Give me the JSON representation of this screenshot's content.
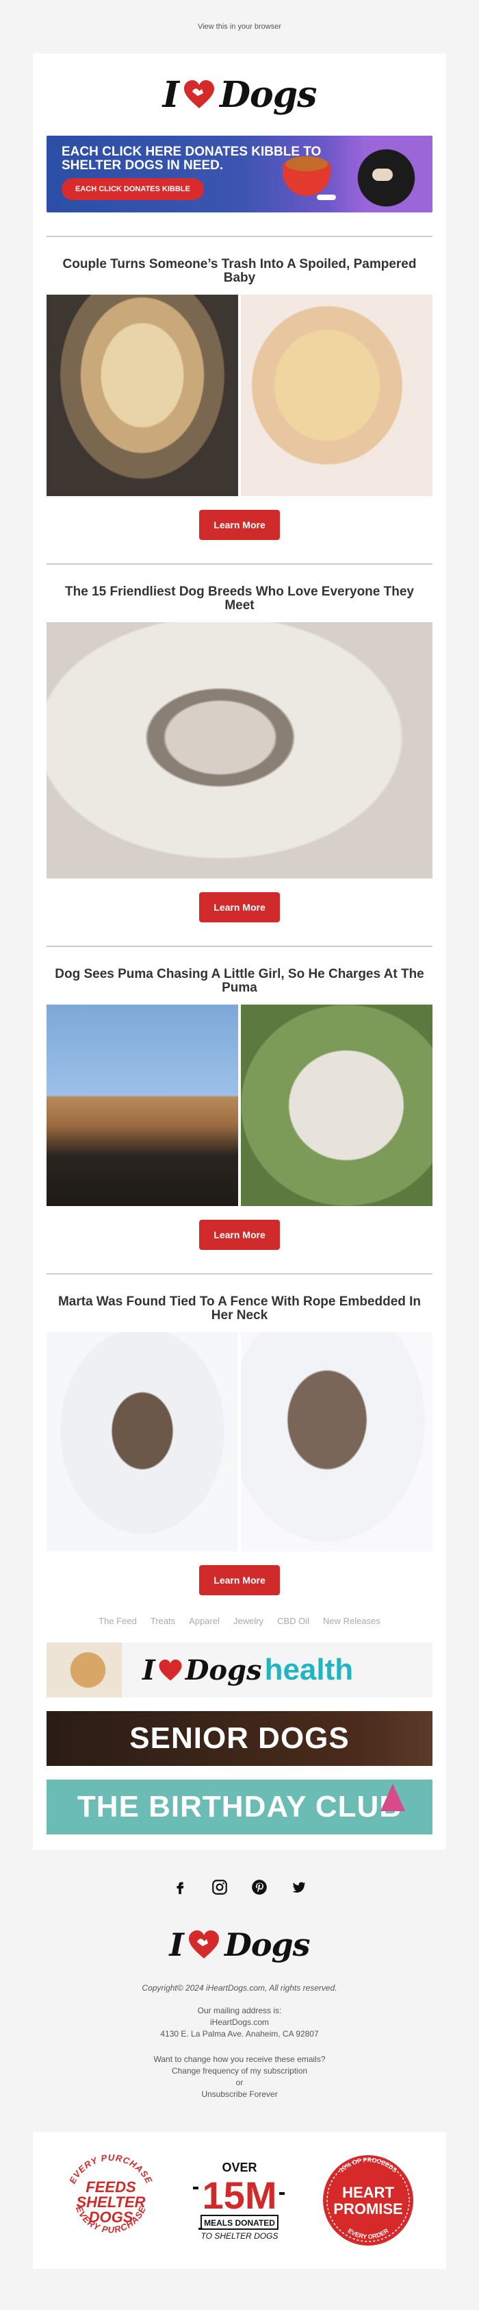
{
  "top_link": "View this in your browser",
  "brand": {
    "left": "I",
    "right": "Dogs"
  },
  "banner": {
    "headline": "EACH CLICK HERE DONATES KIBBLE TO SHELTER DOGS IN NEED.",
    "cta": "EACH CLICK DONATES KIBBLE"
  },
  "articles": [
    {
      "title": "Couple Turns Someone’s Trash Into A Spoiled, Pampered Baby",
      "cta": "Learn More"
    },
    {
      "title": "The 15 Friendliest Dog Breeds Who Love Everyone They Meet",
      "cta": "Learn More"
    },
    {
      "title": "Dog Sees Puma Chasing A Little Girl, So He Charges At The Puma",
      "cta": "Learn More"
    },
    {
      "title": "Marta Was Found Tied To A Fence With Rope Embedded In Her Neck",
      "cta": "Learn More"
    }
  ],
  "nav": [
    "The Feed",
    "Treats",
    "Apparel",
    "Jewelry",
    "CBD Oil",
    "New Releases"
  ],
  "promos": {
    "health_left": "I",
    "health_dogs": "Dogs",
    "health_word": "health",
    "senior": "SENIOR DOGS",
    "birthday": "THE BIRTHDAY CLUB"
  },
  "social_icons": [
    "facebook-icon",
    "instagram-icon",
    "pinterest-icon",
    "twitter-icon"
  ],
  "footer": {
    "copyright": "Copyright© 2024 iHeartDogs.com, All rights reserved.",
    "mailing_label": "Our mailing address is:",
    "mailing_name": "iHeartDogs.com",
    "mailing_address": "4130 E. La Palma Ave. Anaheim, CA 92807",
    "change_q": "Want to change how you receive these emails?",
    "change_freq": "Change frequency of my subscription",
    "or": "or",
    "unsubscribe": "Unsubscribe Forever"
  },
  "badges": {
    "b1_top": "EVERY PURCHASE",
    "b1_mid1": "FEEDS",
    "b1_mid2": "SHELTER",
    "b1_mid3": "DOGS",
    "b1_bottom": "EVERY PURCHASE",
    "b2_over": "OVER",
    "b2_num": "15M",
    "b2_line1": "MEALS DONATED",
    "b2_line2": "TO SHELTER DOGS",
    "b3_top": "10% OF PROCEEDS",
    "b3_mid1": "HEART",
    "b3_mid2": "PROMISE",
    "b3_bottom": "EVERY ORDER"
  },
  "colors": {
    "accent": "#d02a2a",
    "health": "#20b6c1"
  }
}
